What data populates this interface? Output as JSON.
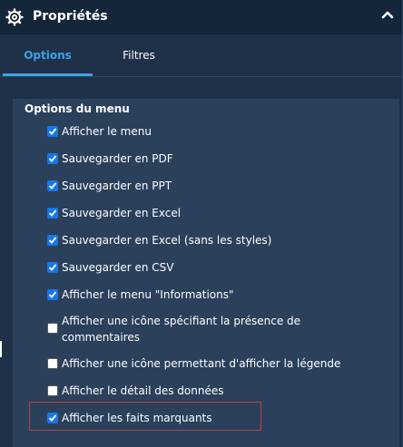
{
  "header": {
    "title": "Propriétés",
    "icon": "gear-icon",
    "collapse_icon": "chevron-up-icon"
  },
  "tabs": [
    {
      "label": "Options",
      "active": true
    },
    {
      "label": "Filtres",
      "active": false
    }
  ],
  "group": {
    "title": "Options du menu",
    "options": [
      {
        "label": "Afficher le menu",
        "checked": true
      },
      {
        "label": "Sauvegarder en PDF",
        "checked": true
      },
      {
        "label": "Sauvegarder en PPT",
        "checked": true
      },
      {
        "label": "Sauvegarder en Excel",
        "checked": true
      },
      {
        "label": "Sauvegarder en Excel (sans les styles)",
        "checked": true
      },
      {
        "label": "Sauvegarder en CSV",
        "checked": true
      },
      {
        "label": "Afficher le menu \"Informations\"",
        "checked": true
      },
      {
        "label_line1": "Afficher une icône spécifiant la présence de",
        "label_line2": "commentaires",
        "checked": false
      },
      {
        "label": "Afficher une icône permettant d'afficher la légende",
        "checked": false
      },
      {
        "label": "Afficher le détail des données",
        "checked": false
      },
      {
        "label": "Afficher les faits marquants",
        "checked": true
      }
    ]
  },
  "colors": {
    "accent": "#39a4e8",
    "checkbox": "#1877e6",
    "highlight_border": "#b8433d",
    "panel_bg": "#1f3148",
    "group_bg": "#2b405b"
  }
}
